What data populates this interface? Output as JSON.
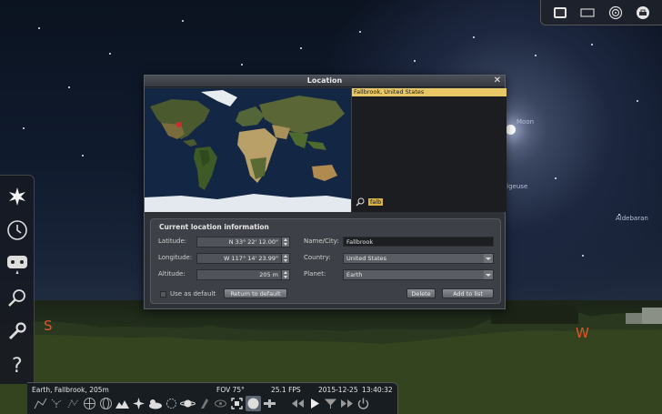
{
  "sky": {
    "labels": {
      "moon": "Moon",
      "betelgeuse": "Betelgeuse",
      "aldebaran": "Aldebaran"
    },
    "cardinals": {
      "south": "S",
      "west": "W"
    }
  },
  "top_toolbar": {
    "icons": [
      "screen-icon",
      "window-icon",
      "target-icon",
      "lock-icon"
    ]
  },
  "left_toolbar": {
    "icons": [
      "sun-icon",
      "clock-icon",
      "sky-culture-icon",
      "search-icon",
      "settings-icon",
      "help-icon"
    ]
  },
  "status_bar": {
    "location": "Earth, Fallbrook, 205m",
    "fov": "FOV 75°",
    "fps": "25.1 FPS",
    "date": "2015-12-25",
    "time": "13:40:32"
  },
  "dialog": {
    "title": "Location",
    "close_label": "✕",
    "selected_location": "Fallbrook, United States",
    "search_value": "falb",
    "info_heading": "Current location information",
    "latitude_label": "Latitude:",
    "latitude_value": "N 33° 22' 12.00\"",
    "longitude_label": "Longitude:",
    "longitude_value": "W 117° 14' 23.99\"",
    "altitude_label": "Altitude:",
    "altitude_value": "205 m",
    "use_default_label": "Use as default",
    "return_default_label": "Return to default",
    "name_label": "Name/City:",
    "name_value": "Fallbrook",
    "country_label": "Country:",
    "country_value": "United States",
    "planet_label": "Planet:",
    "planet_value": "Earth",
    "delete_label": "Delete",
    "add_label": "Add to list"
  },
  "colors": {
    "accent": "#e8c766",
    "cardinal": "#e0562a",
    "panel": "#3d4046"
  }
}
